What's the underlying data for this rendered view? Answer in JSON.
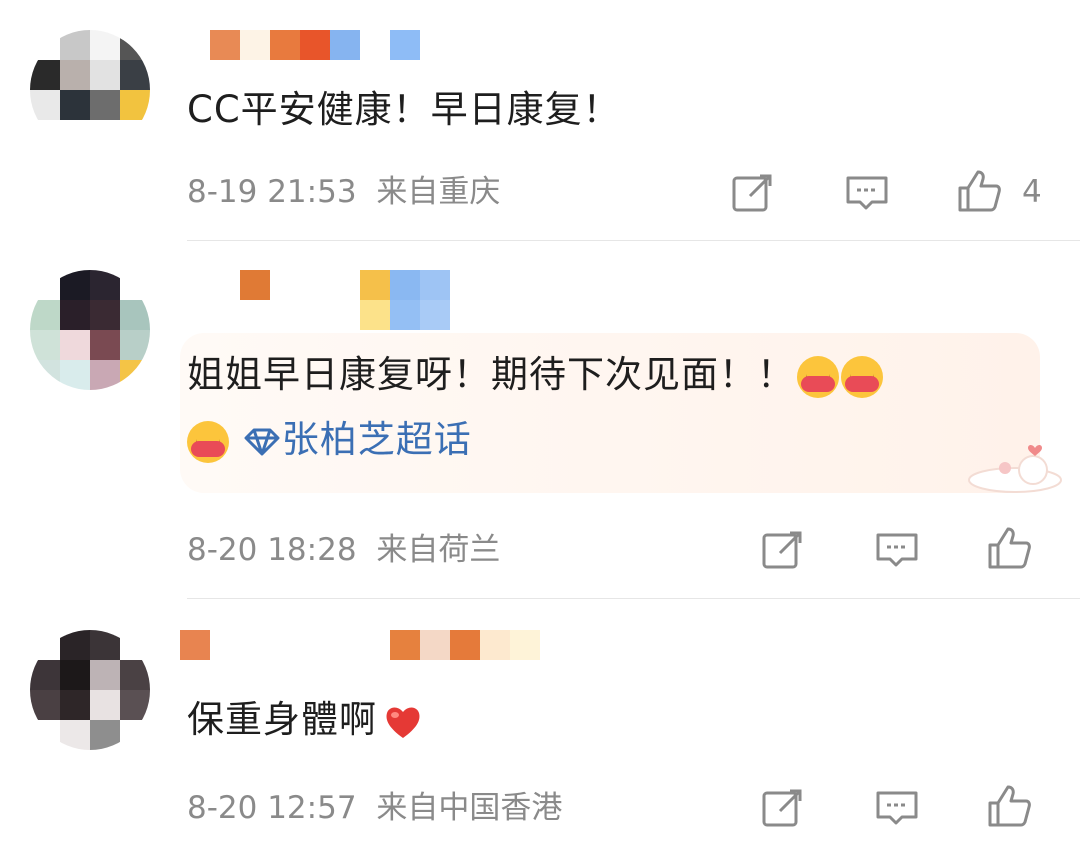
{
  "colors": {
    "meta_text": "#8a8a8a",
    "topic_link": "#3b6fb4",
    "icon_stroke": "#8a8a8a",
    "heart": "#e53935"
  },
  "comments": [
    {
      "text": "CC平安健康！早日康复！",
      "timestamp": "8-19 21:53",
      "location": "来自重庆",
      "like_count": "4",
      "emoji_count": 0,
      "has_topic": false
    },
    {
      "text": "姐姐早日康复呀！期待下次见面！！",
      "topic_label": "张柏芝超话",
      "timestamp": "8-20 18:28",
      "location": "来自荷兰",
      "like_count": "",
      "emoji_name": "hug-emoji",
      "topic_icon": "diamond-icon"
    },
    {
      "text": "保重身體啊",
      "timestamp": "8-20 12:57",
      "location": "来自中国香港",
      "like_count": "",
      "emoji_name": "red-heart-emoji"
    }
  ],
  "icons": {
    "repost": "repost-icon",
    "comment": "comment-icon",
    "like": "thumbs-up-icon"
  }
}
